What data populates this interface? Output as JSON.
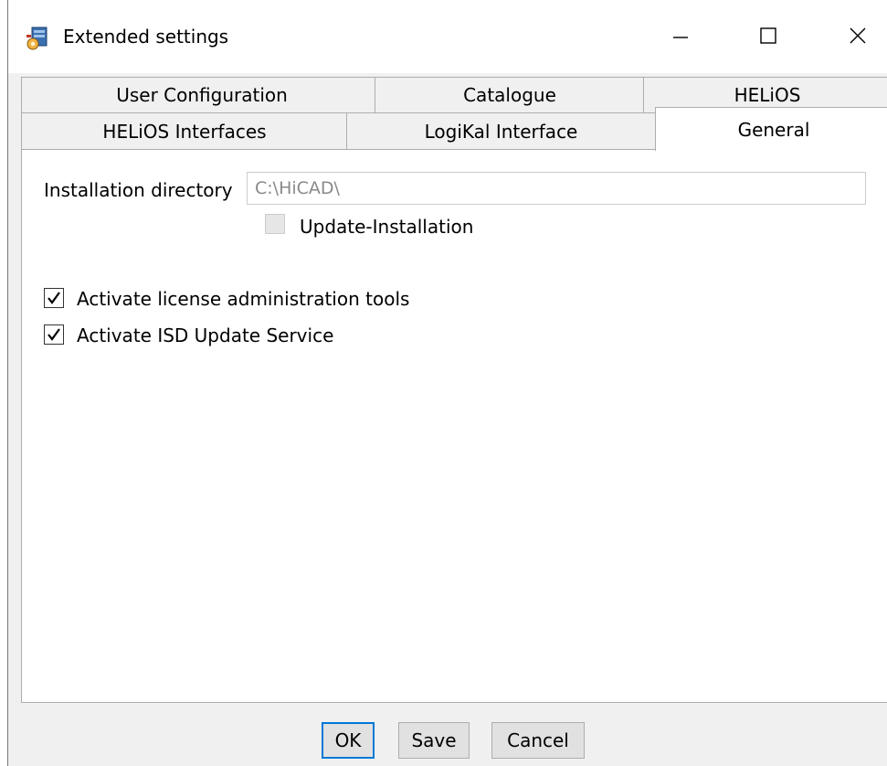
{
  "window": {
    "title": "Extended settings",
    "controls": {
      "minimize_icon": "minimize-icon",
      "maximize_icon": "maximize-icon",
      "close_icon": "close-icon"
    }
  },
  "tabs": {
    "row1": [
      {
        "label": "User Configuration"
      },
      {
        "label": "Catalogue"
      },
      {
        "label": "HELiOS"
      }
    ],
    "row2": [
      {
        "label": "HELiOS Interfaces"
      },
      {
        "label": "LogiKal Interface"
      },
      {
        "label": "General",
        "active": true
      }
    ]
  },
  "general": {
    "install_dir_label": "Installation directory",
    "install_dir_value": "C:\\HiCAD\\",
    "update_installation_label": "Update-Installation",
    "update_installation_checked": false,
    "update_installation_enabled": false,
    "license_tools_label": "Activate license administration tools",
    "license_tools_checked": true,
    "isd_update_label": "Activate ISD Update Service",
    "isd_update_checked": true
  },
  "buttons": {
    "ok": "OK",
    "save": "Save",
    "cancel": "Cancel"
  },
  "colors": {
    "accent": "#0078d7",
    "window_bg": "#f0f0f0",
    "panel_bg": "#ffffff"
  }
}
